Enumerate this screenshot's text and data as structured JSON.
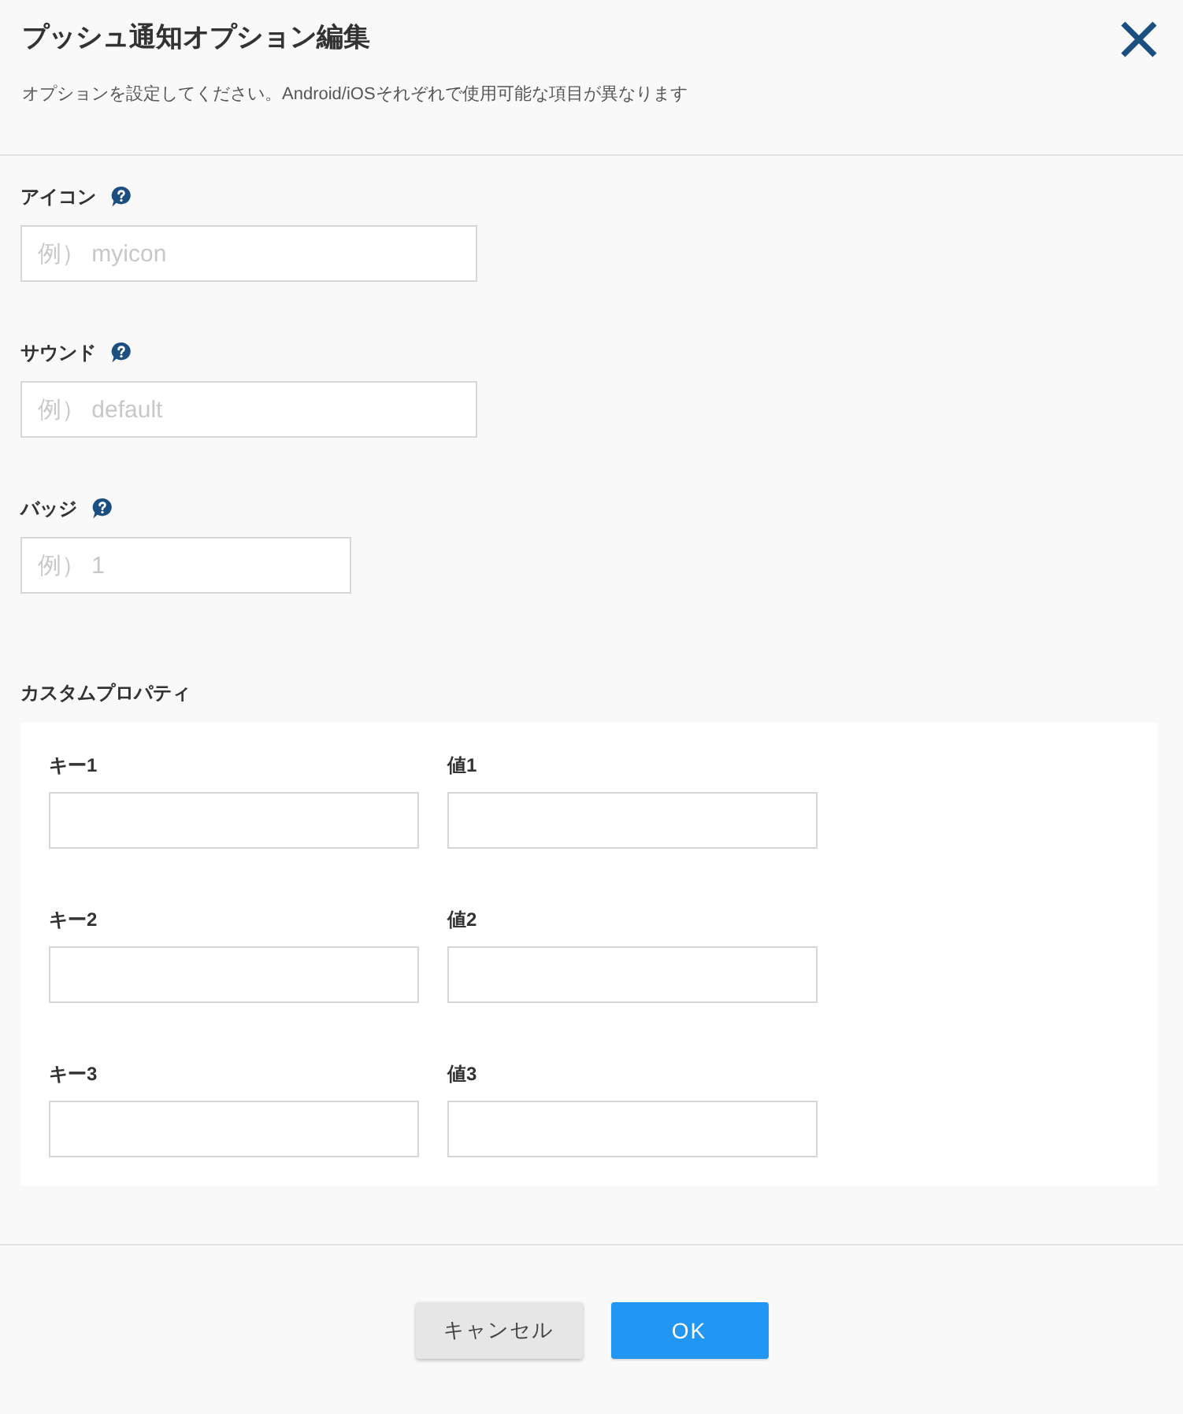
{
  "dialog": {
    "title": "プッシュ通知オプション編集",
    "subtitle": "オプションを設定してください。Android/iOSそれぞれで使用可能な項目が異なります"
  },
  "fields": [
    {
      "label": "アイコン",
      "placeholder": "例） myicon",
      "kind": "text"
    },
    {
      "label": "サウンド",
      "placeholder": "例） default",
      "kind": "text"
    },
    {
      "label": "バッジ",
      "placeholder": "例） 1",
      "kind": "number"
    }
  ],
  "custom_properties": {
    "label": "カスタムプロパティ",
    "rows": [
      {
        "key_label": "キー1",
        "value_label": "値1"
      },
      {
        "key_label": "キー2",
        "value_label": "値2"
      },
      {
        "key_label": "キー3",
        "value_label": "値3"
      }
    ]
  },
  "buttons": [
    {
      "label": "キャンセル",
      "kind": "secondary"
    },
    {
      "label": "OK",
      "kind": "primary"
    }
  ]
}
